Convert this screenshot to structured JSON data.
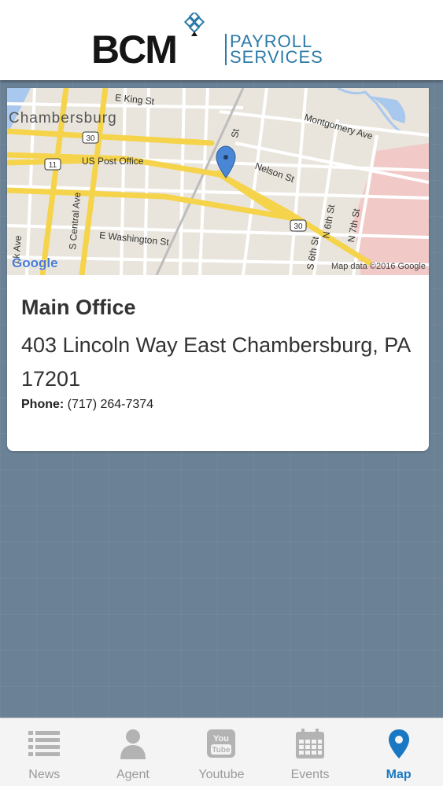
{
  "header": {
    "logo_bcm": "BCM",
    "logo_line1": "PAYROLL",
    "logo_line2": "SERVICES",
    "brand_color": "#2c7aa8"
  },
  "map": {
    "city": "Chambersburg",
    "streets": [
      "E King St",
      "Montgomery Ave",
      "Nelson St",
      "US Post Office",
      "S Central Ave",
      "E Washington St",
      "N 6th St",
      "N 7th St",
      "S 6th St",
      "ck Ave",
      "St"
    ],
    "shields": [
      "30",
      "11",
      "30"
    ],
    "google_logo": "Google",
    "attribution": "Map data ©2016 Google",
    "marker_icon": "map-pin-icon"
  },
  "office": {
    "title": "Main Office",
    "address": "403 Lincoln Way East Chambersburg, PA 17201",
    "phone_label": "Phone:",
    "phone_value": "(717) 264-7374"
  },
  "tabs": [
    {
      "label": "News",
      "icon": "list-icon"
    },
    {
      "label": "Agent",
      "icon": "person-icon"
    },
    {
      "label": "Youtube",
      "icon": "youtube-icon"
    },
    {
      "label": "Events",
      "icon": "calendar-icon"
    },
    {
      "label": "Map",
      "icon": "map-pin-icon",
      "active": true
    }
  ],
  "colors": {
    "active_tab": "#1a78c2",
    "inactive_tab": "#9a9a9a",
    "background": "#6b8196"
  }
}
